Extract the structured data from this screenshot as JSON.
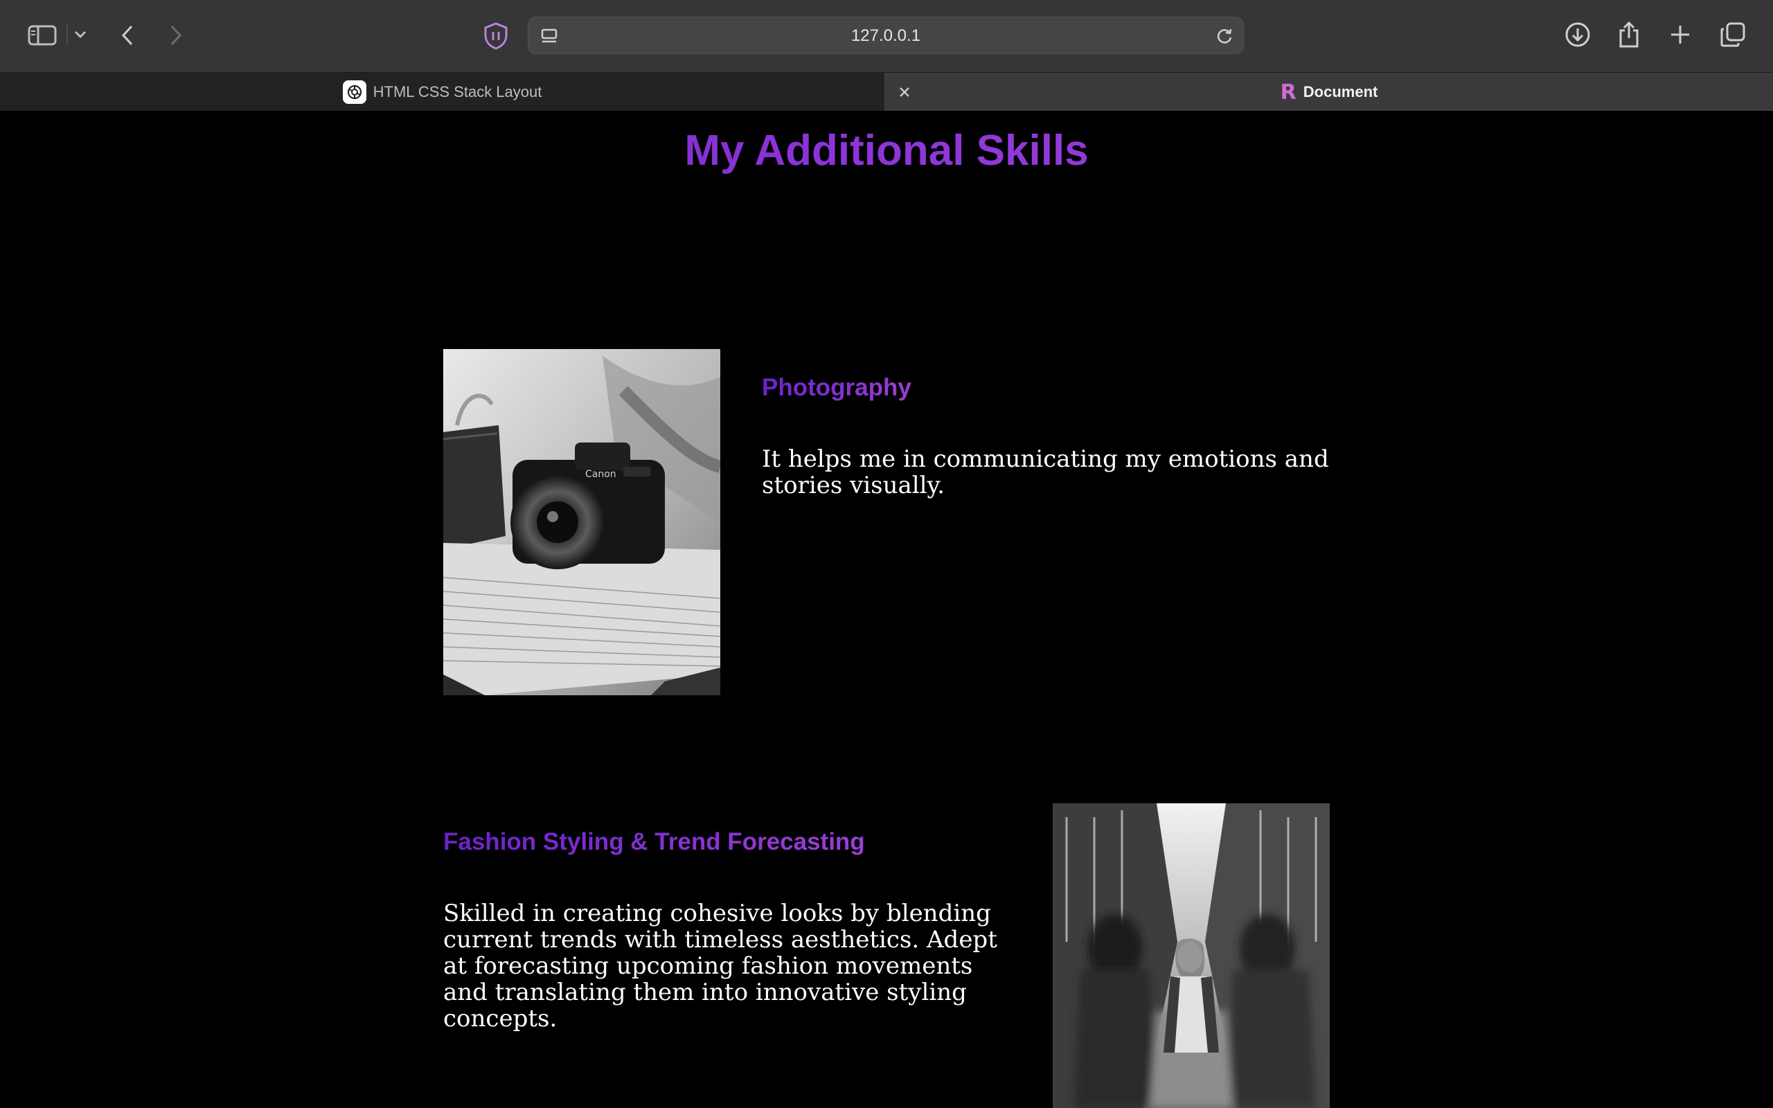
{
  "browser": {
    "url": "127.0.0.1",
    "tabs": [
      {
        "title": "HTML CSS Stack Layout",
        "active": false
      },
      {
        "title": "Document",
        "active": true
      }
    ]
  },
  "page": {
    "title": "My Additional Skills",
    "skills": [
      {
        "heading": "Photography",
        "text": "It helps me in communicating my emotions and stories visually.",
        "image": "camera-on-magazines-photo"
      },
      {
        "heading": "Fashion Styling & Trend Forecasting",
        "text": "Skilled in creating cohesive looks by blending current trends with timeless aesthetics. Adept at forecasting upcoming fashion movements and translating them into innovative styling concepts.",
        "image": "crowd-motion-blur-photo"
      }
    ]
  },
  "colors": {
    "accent": "#8a2be2",
    "background": "#000000",
    "body_text": "#ffffff"
  }
}
